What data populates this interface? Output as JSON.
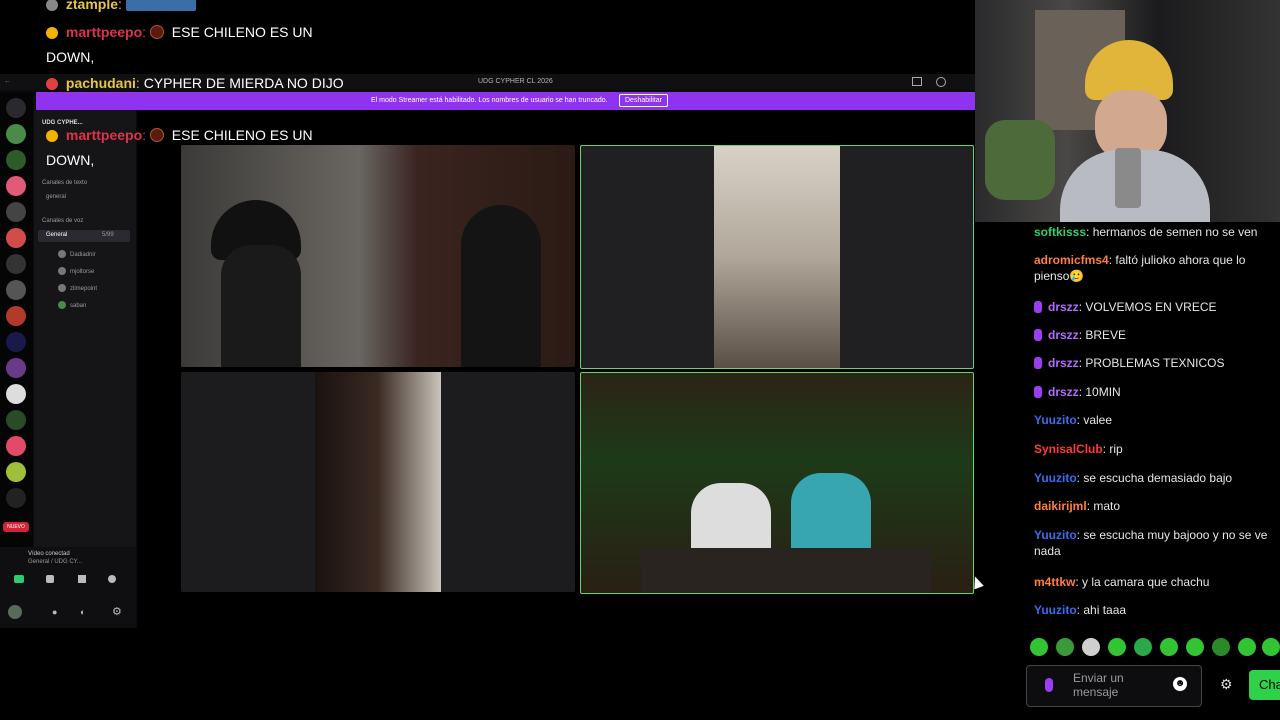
{
  "overlay_chat": [
    {
      "user": "ztample",
      "text": "",
      "color": "#e8c547"
    },
    {
      "user": "marttpeepo",
      "text": "ESE CHILENO ES UN",
      "color": "#e0324b"
    },
    {
      "user": "",
      "text": "DOWN,",
      "color": "#ffffff"
    },
    {
      "user": "pachudani",
      "text": "CYPHER DE MIERDA NO DIJO",
      "color": "#e8c547"
    },
    {
      "user": "marttpeepo",
      "text": "ESE CHILENO ES UN",
      "color": "#e0324b"
    },
    {
      "user": "",
      "text": "DOWN,",
      "color": "#ffffff"
    }
  ],
  "discord": {
    "window_title": "UDG CYPHER CL 2026",
    "streamer_banner": "El modo Streamer está habilitado. Los nombres de usuario se han truncado.",
    "disable_button": "Deshabilitar",
    "server_name": "UDG CYPHE...",
    "text_channels_header": "Canales de texto",
    "text_channel": "general",
    "voice_channels_header": "Canales de voz",
    "voice_channel": "General",
    "voice_channel_count": "5/99",
    "voice_users": [
      "Dadiadnir",
      "mjoltorse",
      "zlimepoint",
      "saban"
    ],
    "video_connected": "Vídeo conectad",
    "video_sub": "General / UDG CY...",
    "new_badge": "NUEVO"
  },
  "chat": {
    "messages": [
      {
        "user": "softkisss",
        "text": "hermanos de semen no se ven",
        "color": "#2ed16e",
        "badge": false
      },
      {
        "user": "adromicfms4",
        "text": "faltó julioko ahora que lo pienso🥲",
        "color": "#ff7f3f",
        "badge": false
      },
      {
        "user": "drszz",
        "text": "VOLVEMOS EN VRECE",
        "color": "#b26cff",
        "badge": true
      },
      {
        "user": "drszz",
        "text": "BREVE",
        "color": "#b26cff",
        "badge": true
      },
      {
        "user": "drszz",
        "text": "PROBLEMAS TEXNICOS",
        "color": "#b26cff",
        "badge": true
      },
      {
        "user": "drszz",
        "text": "10MIN",
        "color": "#b26cff",
        "badge": true
      },
      {
        "user": "Yuuzito",
        "text": "valee",
        "color": "#3a6cf2",
        "badge": false
      },
      {
        "user": "SynisalClub",
        "text": "rip",
        "color": "#ff3a3a",
        "badge": false
      },
      {
        "user": "Yuuzito",
        "text": "se escucha demasiado bajo",
        "color": "#3a6cf2",
        "badge": false
      },
      {
        "user": "daikirijml",
        "text": "mato",
        "color": "#ff7f3f",
        "badge": false
      },
      {
        "user": "Yuuzito",
        "text": "se escucha muy bajooo y no se ve nada",
        "color": "#3a6cf2",
        "badge": false
      },
      {
        "user": "m4ttkw",
        "text": "y la camara que chachu",
        "color": "#ff7f3f",
        "badge": false
      },
      {
        "user": "Yuuzito",
        "text": "ahi taaa",
        "color": "#3a6cf2",
        "badge": false
      }
    ],
    "input_placeholder": "Enviar un mensaje",
    "send_button": "Cha"
  },
  "icons": {
    "discord": "discord-icon",
    "gear": "gear-icon",
    "smile": "smile-icon",
    "mic": "mic-icon",
    "cursor": "cursor-icon"
  }
}
